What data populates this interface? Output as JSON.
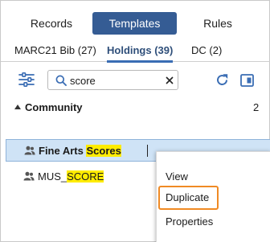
{
  "main_tabs": [
    {
      "label": "Records",
      "active": false
    },
    {
      "label": "Templates",
      "active": true
    },
    {
      "label": "Rules",
      "active": false
    }
  ],
  "sub_tabs": [
    {
      "label": "MARC21 Bib (27)",
      "active": false
    },
    {
      "label": "Holdings (39)",
      "active": true
    },
    {
      "label": "DC (2)",
      "active": false
    }
  ],
  "toolbar": {
    "search_value": "score",
    "icons": [
      "filter-settings-icon",
      "search-icon",
      "clear-icon",
      "refresh-icon",
      "panel-layout-icon"
    ]
  },
  "tree": {
    "group": {
      "label": "Community",
      "count": "2",
      "expanded": true
    },
    "items": [
      {
        "prefix": "Fine Arts ",
        "match": "Scores",
        "suffix": "",
        "selected": true
      },
      {
        "prefix": "MUS_",
        "match": "SCORE",
        "suffix": "",
        "selected": false
      }
    ]
  },
  "context_menu": {
    "items": [
      "View",
      "Duplicate",
      "Properties"
    ],
    "highlighted": "Duplicate"
  },
  "colors": {
    "active_tab_bg": "#355c94",
    "active_subtab_underline": "#3a6db4",
    "selected_row_bg": "#cfe3f6",
    "search_match_highlight": "#ffec00",
    "menu_focus_outline": "#f08a24"
  }
}
